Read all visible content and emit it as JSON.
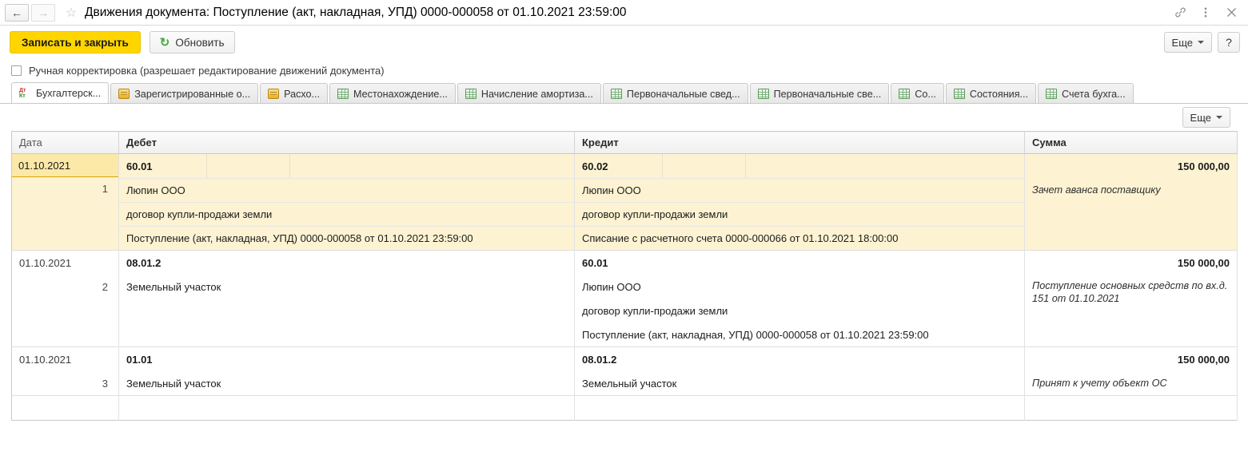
{
  "titlebar": {
    "back_icon": "arrow-left-icon",
    "forward_icon": "arrow-right-icon",
    "favorite_icon": "star-icon",
    "title": "Движения документа: Поступление (акт, накладная, УПД) 0000-000058 от 01.10.2021 23:59:00",
    "link_icon": "link-icon",
    "menu_icon": "kebab-menu-icon",
    "close_icon": "close-icon"
  },
  "commandbar": {
    "save_and_close": "Записать и закрыть",
    "refresh": "Обновить",
    "refresh_icon": "refresh-icon",
    "more": "Еще",
    "help": "?"
  },
  "manual_correction": {
    "label": "Ручная корректировка (разрешает редактирование движений документа)",
    "checked": false
  },
  "tabs": [
    {
      "label": "Бухгалтерск...",
      "icon": "debit-credit-icon",
      "active": true
    },
    {
      "label": "Зарегистрированные о...",
      "icon": "register-icon",
      "active": false
    },
    {
      "label": "Расхо...",
      "icon": "register-icon",
      "active": false
    },
    {
      "label": "Местонахождение...",
      "icon": "grid-icon",
      "active": false
    },
    {
      "label": "Начисление амортиза...",
      "icon": "grid-icon",
      "active": false
    },
    {
      "label": "Первоначальные свед...",
      "icon": "grid-icon",
      "active": false
    },
    {
      "label": "Первоначальные све...",
      "icon": "grid-icon",
      "active": false
    },
    {
      "label": "Со...",
      "icon": "grid-icon",
      "active": false
    },
    {
      "label": "Состояния...",
      "icon": "grid-icon",
      "active": false
    },
    {
      "label": "Счета бухга...",
      "icon": "grid-icon",
      "active": false
    }
  ],
  "table_toolbar": {
    "more": "Еще"
  },
  "grid": {
    "headers": {
      "date": "Дата",
      "debit": "Дебет",
      "credit": "Кредит",
      "amount": "Сумма"
    },
    "rows": [
      {
        "highlighted": true,
        "date": "01.10.2021",
        "index": "1",
        "debit_account": "60.01",
        "credit_account": "60.02",
        "amount": "150 000,00",
        "debit_lines": [
          "Люпин ООО",
          "договор купли-продажи земли",
          "Поступление (акт, накладная, УПД) 0000-000058 от 01.10.2021 23:59:00"
        ],
        "credit_lines": [
          "Люпин ООО",
          "договор купли-продажи земли",
          "Списание с расчетного счета 0000-000066 от 01.10.2021 18:00:00"
        ],
        "note": "Зачет аванса поставщику"
      },
      {
        "highlighted": false,
        "date": "01.10.2021",
        "index": "2",
        "debit_account": "08.01.2",
        "credit_account": "60.01",
        "amount": "150 000,00",
        "debit_lines": [
          "Земельный участок",
          "",
          ""
        ],
        "credit_lines": [
          "Люпин ООО",
          "договор купли-продажи земли",
          "Поступление (акт, накладная, УПД) 0000-000058 от 01.10.2021 23:59:00"
        ],
        "note": "Поступление основных средств по вх.д. 151 от 01.10.2021"
      },
      {
        "highlighted": false,
        "date": "01.10.2021",
        "index": "3",
        "debit_account": "01.01",
        "credit_account": "08.01.2",
        "amount": "150 000,00",
        "debit_lines": [
          "Земельный участок"
        ],
        "credit_lines": [
          "Земельный участок"
        ],
        "note": "Принят к учету объект ОС"
      }
    ]
  },
  "colors": {
    "accent_yellow": "#ffd500",
    "row_highlight": "#fdf3d2",
    "selected_cell": "#fce9a8",
    "selected_border": "#d9a300",
    "refresh_green": "#4aa93f"
  }
}
